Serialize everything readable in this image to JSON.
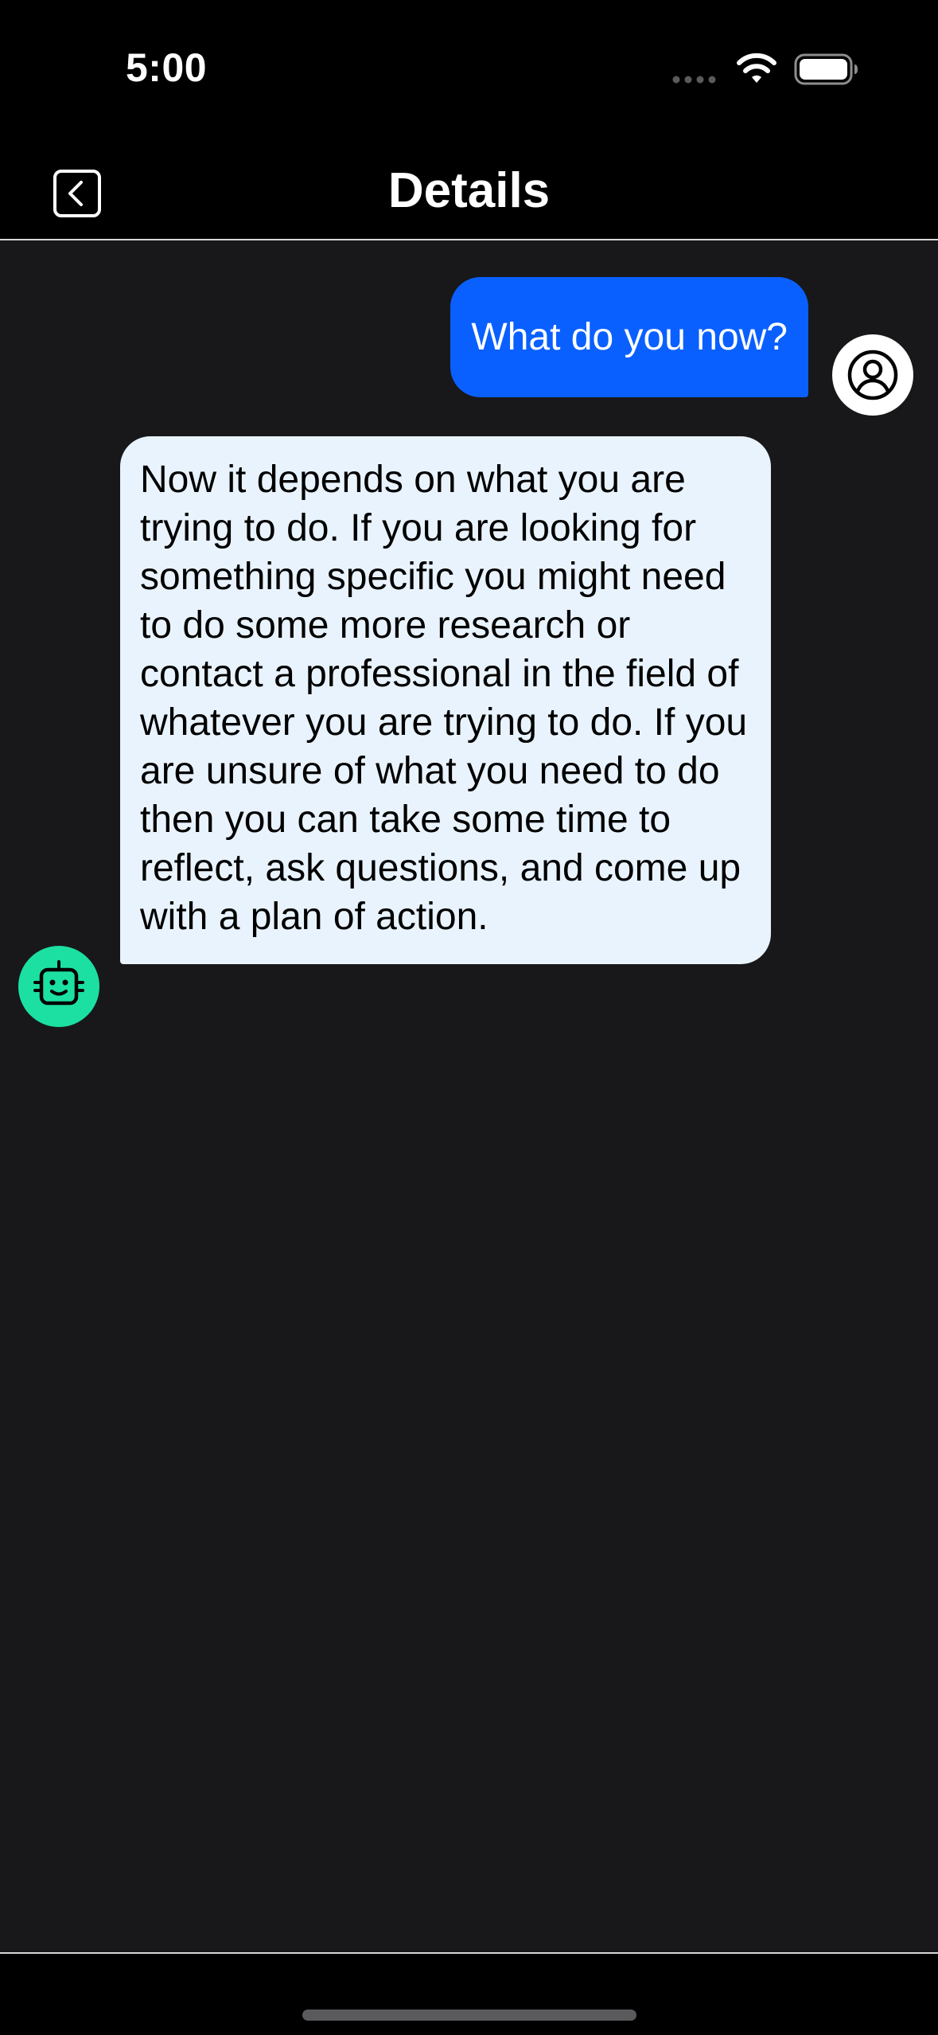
{
  "status_bar": {
    "time": "5:00"
  },
  "nav": {
    "title": "Details",
    "back_icon": "chevron-left-square-icon"
  },
  "conversation": {
    "messages": [
      {
        "role": "user",
        "text": "What do you now?",
        "avatar_icon": "person-circle-icon"
      },
      {
        "role": "assistant",
        "text": "Now it depends on what you are trying to do. If you are looking for something specific you might need to do some more research or contact a professional in the field of whatever you are trying to do. If you are unsure of what you need to do then you can take some time to reflect, ask questions, and come up with a plan of action.",
        "avatar_icon": "robot-face-icon"
      }
    ]
  },
  "colors": {
    "user_bubble": "#0a60ff",
    "assistant_bubble": "#e9f3fd",
    "assistant_avatar": "#1ce0a2",
    "background": "#18181a"
  }
}
